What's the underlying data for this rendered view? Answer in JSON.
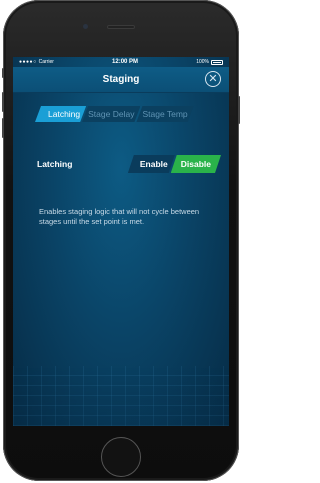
{
  "status_bar": {
    "signal": "●●●●○",
    "carrier": "Carrier",
    "time": "12:00 PM",
    "battery_percent": "100%"
  },
  "nav": {
    "title": "Staging",
    "close_icon": "close-circle-icon",
    "close_glyph": "✕"
  },
  "tabs": [
    {
      "label": "Latching",
      "active": true
    },
    {
      "label": "Stage Delay",
      "active": false
    },
    {
      "label": "Stage Temp",
      "active": false
    }
  ],
  "setting": {
    "label": "Latching",
    "options": [
      {
        "label": "Enable",
        "selected": false
      },
      {
        "label": "Disable",
        "selected": true
      }
    ]
  },
  "description": "Enables staging logic that will not cycle between stages until the set point is met.",
  "colors": {
    "accent": "#1a9fd6",
    "selected": "#2ab34a",
    "background": "#0a4467"
  }
}
